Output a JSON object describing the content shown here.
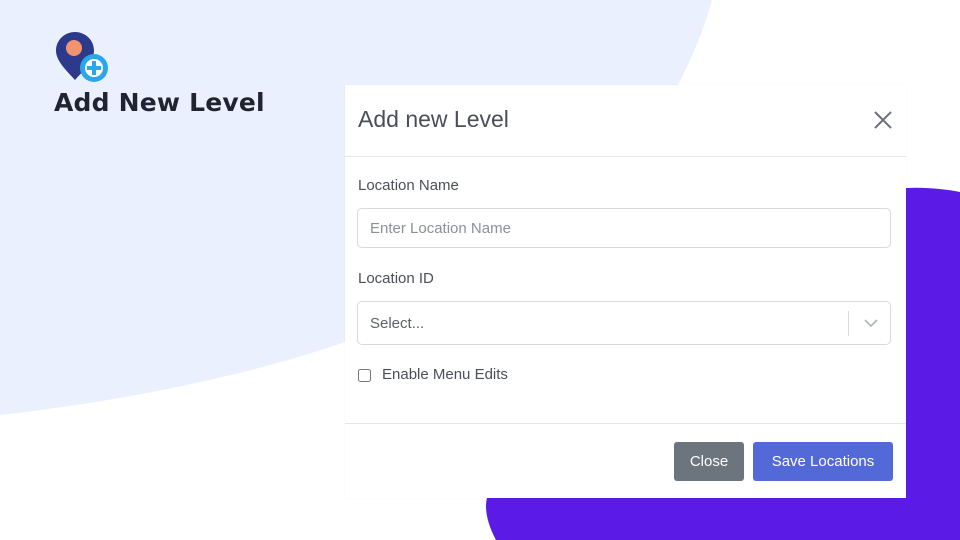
{
  "slide": {
    "title": "Add New Level",
    "logo_icon": "location-pin-plus-icon"
  },
  "modal": {
    "title": "Add new Level",
    "close_icon": "close-icon",
    "fields": {
      "location_name": {
        "label": "Location Name",
        "placeholder": "Enter Location Name",
        "value": ""
      },
      "location_id": {
        "label": "Location ID",
        "selected": "Select..."
      },
      "enable_menu_edits": {
        "label": "Enable Menu Edits",
        "checked": false
      }
    },
    "footer": {
      "close_label": "Close",
      "save_label": "Save Locations"
    }
  },
  "colors": {
    "background_blob": "#eaf0fd",
    "accent_purple": "#5b1ae6",
    "primary_button": "#5369d8",
    "secondary_button": "#6c757d",
    "logo_pin": "#2d3a8c",
    "logo_dot": "#f0946f",
    "logo_plus": "#2aa7e8"
  }
}
